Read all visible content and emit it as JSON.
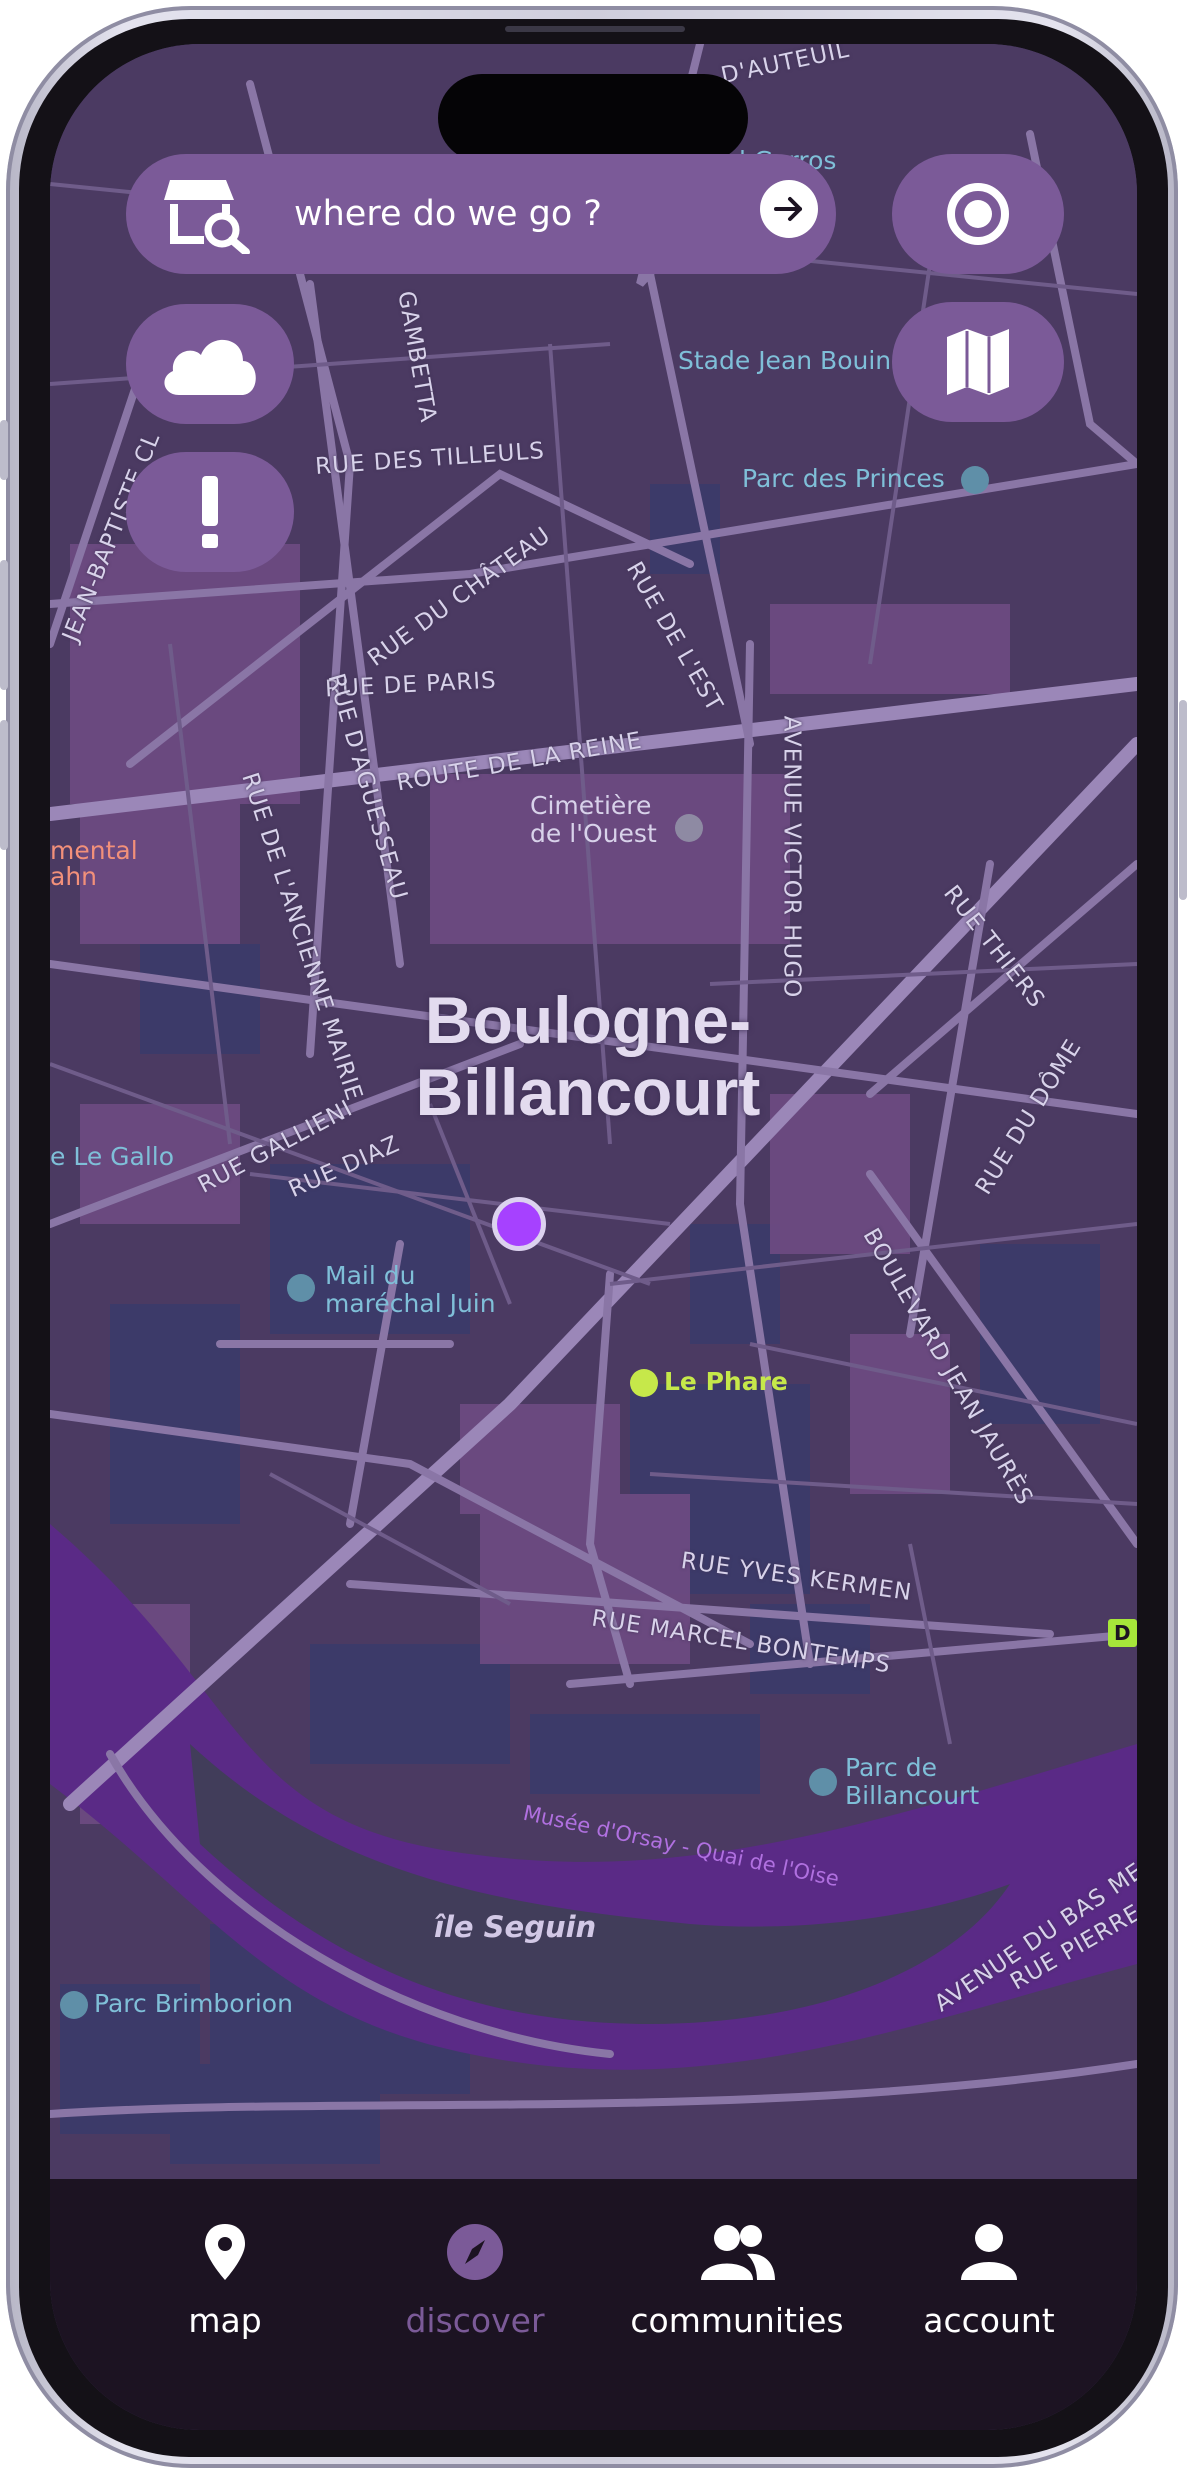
{
  "search": {
    "placeholder": "where do we go ?"
  },
  "map": {
    "city": {
      "line1": "Boulogne-",
      "line2": "Billancourt"
    },
    "streets": {
      "auteuil": "D'AUTEUIL",
      "gambetta": "GAMBETTA",
      "tilleuls": "RUE DES TILLEULS",
      "chateau": "RUE DU CHÂTEAU",
      "est": "RUE DE L'EST",
      "paris": "RUE DE PARIS",
      "reine": "ROUTE DE LA REINE",
      "aguesseau": "RUE D'AGUESSEAU",
      "ancienne_mairie": "RUE DE L'ANCIENNE MAIRIE",
      "victor_hugo": "AVENUE VICTOR HUGO",
      "thiers": "RUE THIERS",
      "dome": "RUE DU DÔME",
      "gallieni": "RUE GALLIENI",
      "diaz": "RUE DIAZ",
      "jaures": "BOULEVARD JEAN JAURÈS",
      "yves_kermen": "RUE YVES KERMEN",
      "bontemps": "RUE MARCEL BONTEMPS",
      "bas_meudon": "AVENUE DU BAS MEUDON",
      "pierre_po": "RUE PIERRE PO",
      "jean_bapt": "JEAN-BAPTISTE CL"
    },
    "places": {
      "garros": "d Garros",
      "stade": "Stade Jean Bouin",
      "princes": "Parc des Princes",
      "cimetiere_1": "Cimetière",
      "cimetiere_2": "de l'Ouest",
      "mental_1": "mental",
      "mental_2": "ahn",
      "gallo": "e Le Gallo",
      "mail_1": "Mail du",
      "mail_2": "maréchal Juin",
      "phare": "Le Phare",
      "parc_bill_1": "Parc de",
      "parc_bill_2": "Billancourt",
      "brimborion": "Parc Brimborion",
      "quai": "Musée d'Orsay - Quai de l'Oise",
      "seguin": "île Seguin",
      "d_badge": "D"
    }
  },
  "nav": {
    "items": [
      {
        "label": "map",
        "active": false
      },
      {
        "label": "discover",
        "active": true
      },
      {
        "label": "communities",
        "active": false
      },
      {
        "label": "account",
        "active": false
      }
    ]
  },
  "colors": {
    "accent": "#7b5a98",
    "active_nav": "#7b5a98",
    "user_dot": "#a641ff",
    "nav_bg": "#1c1322",
    "river": "#5a2a86"
  },
  "icons": [
    "store-search-icon",
    "arrow-right-icon",
    "target-icon",
    "cloud-icon",
    "map-icon",
    "alert-icon",
    "map-pin-icon",
    "compass-icon",
    "users-icon",
    "person-icon"
  ]
}
